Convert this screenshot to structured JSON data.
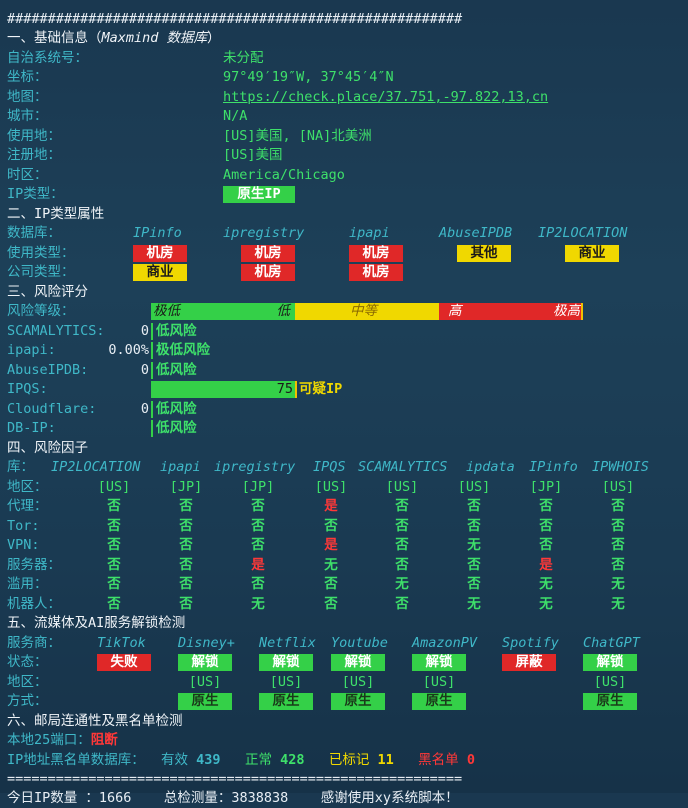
{
  "rule_top": "########################################################",
  "rule_bottom": "========================================================",
  "footer_partial": "今日IP数量 ：1666    总检测量：3838838    感谢使用xy系统脚本！",
  "s1": {
    "title": "一、基础信息（",
    "title_italic": "Maxmind 数据库",
    "title_end": "）",
    "rows": [
      {
        "label": "自治系统号：",
        "value": "未分配"
      },
      {
        "label": "坐标：",
        "value": "97°49′19″W, 37°45′4″N"
      },
      {
        "label": "地图：",
        "value": "https://check.place/37.751,-97.822,13,cn"
      },
      {
        "label": "城市：",
        "value": "N/A"
      },
      {
        "label": "使用地：",
        "value": "[US]美国, [NA]北美洲"
      },
      {
        "label": "注册地：",
        "value": "[US]美国"
      },
      {
        "label": "时区：",
        "value": "America/Chicago"
      },
      {
        "label": "IP类型：",
        "value": "原生IP"
      }
    ]
  },
  "s2": {
    "title": "二、IP类型属性",
    "db_label": "数据库：",
    "dbs": [
      "IPinfo",
      "ipregistry",
      "ipapi",
      "AbuseIPDB",
      "IP2LOCATION"
    ],
    "usage_label": "使用类型：",
    "usage": [
      "机房",
      "机房",
      "机房",
      "其他",
      "商业"
    ],
    "company_label": "公司类型：",
    "company": [
      "商业",
      "机房",
      "机房"
    ]
  },
  "s3": {
    "title": "三、风险评分",
    "level_label": "风险等级：",
    "levels": [
      "极低",
      "低",
      "中等",
      "高",
      "极高"
    ],
    "rows": [
      {
        "label": "SCAMALYTICS:",
        "score": "0",
        "text": "低风险",
        "fill": 0
      },
      {
        "label": "ipapi:",
        "score": "0.00%",
        "text": "极低风险",
        "fill": 0
      },
      {
        "label": "AbuseIPDB:",
        "score": "0",
        "text": "低风险",
        "fill": 0
      },
      {
        "label": "IPQS:",
        "score": "75",
        "text": "可疑IP",
        "fill": 75
      },
      {
        "label": "Cloudflare:",
        "score": "0",
        "text": "低风险",
        "fill": 0
      },
      {
        "label": "DB-IP:",
        "score": "",
        "text": "低风险",
        "fill": 0
      }
    ]
  },
  "s4": {
    "title": "四、风险因子",
    "lib_label": "库：",
    "libs": [
      "IP2LOCATION",
      "ipapi",
      "ipregistry",
      "IPQS",
      "SCAMALYTICS",
      "ipdata",
      "IPinfo",
      "IPWHOIS"
    ],
    "rows": [
      {
        "label": "地区：",
        "cells": [
          "[US]",
          "[JP]",
          "[JP]",
          "[US]",
          "[US]",
          "[US]",
          "[JP]",
          "[US]"
        ]
      },
      {
        "label": "代理：",
        "cells": [
          "否",
          "否",
          "否",
          "是",
          "否",
          "否",
          "否",
          "否"
        ]
      },
      {
        "label": "Tor:",
        "cells": [
          "否",
          "否",
          "否",
          "否",
          "否",
          "否",
          "否",
          "否"
        ]
      },
      {
        "label": "VPN:",
        "cells": [
          "否",
          "否",
          "否",
          "是",
          "否",
          "无",
          "否",
          "否"
        ]
      },
      {
        "label": "服务器：",
        "cells": [
          "否",
          "否",
          "是",
          "无",
          "否",
          "否",
          "是",
          "否"
        ]
      },
      {
        "label": "滥用：",
        "cells": [
          "否",
          "否",
          "否",
          "否",
          "无",
          "否",
          "无",
          "无"
        ]
      },
      {
        "label": "机器人：",
        "cells": [
          "否",
          "否",
          "无",
          "否",
          "否",
          "无",
          "无",
          "无"
        ]
      }
    ]
  },
  "s5": {
    "title": "五、流媒体及AI服务解锁检测",
    "svc_label": "服务商：",
    "services": [
      "TikTok",
      "Disney+",
      "Netflix",
      "Youtube",
      "AmazonPV",
      "Spotify",
      "ChatGPT"
    ],
    "status_label": "状态：",
    "status": [
      "失败",
      "解锁",
      "解锁",
      "解锁",
      "解锁",
      "屏蔽",
      "解锁"
    ],
    "status_colors": [
      "#e02828",
      "#34d048",
      "#34d048",
      "#34d048",
      "#34d048",
      "#e02828",
      "#34d048"
    ],
    "region_label": "地区：",
    "regions": [
      "",
      "[US]",
      "[US]",
      "[US]",
      "[US]",
      "",
      "[US]"
    ],
    "method_label": "方式：",
    "methods": [
      "",
      "原生",
      "原生",
      "原生",
      "原生",
      "",
      "原生"
    ]
  },
  "s6": {
    "title": "六、邮局连通性及黑名单检测",
    "port_label": "本地25端口：",
    "port_value": "阻断",
    "bl_label": "IP地址黑名单数据库：",
    "valid_label": "有效",
    "valid": "439",
    "normal_label": "正常",
    "normal": "428",
    "marked_label": "已标记",
    "marked": "11",
    "black_label": "黑名单",
    "black": "0"
  },
  "colors": {
    "label": "#3fb8c8",
    "value": "#3ee06a",
    "red": "#e02828",
    "yellow": "#f0d800",
    "green": "#34d048"
  }
}
